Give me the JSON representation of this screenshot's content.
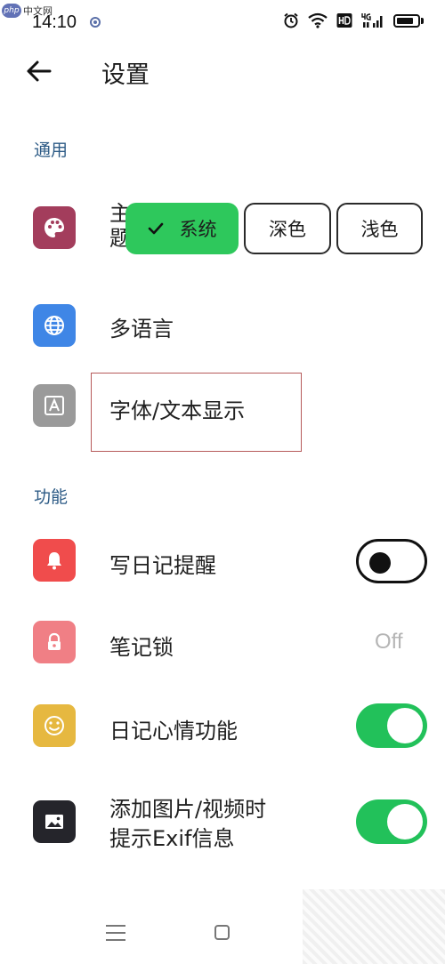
{
  "status_bar": {
    "time": "14:10",
    "watermark": "中文网",
    "watermark_logo": "php"
  },
  "header": {
    "title": "设置"
  },
  "sections": {
    "general": "通用",
    "features": "功能"
  },
  "rows": {
    "theme": {
      "label_line1": "主",
      "label_line2": "题",
      "icon": "palette-icon",
      "icon_color": "#a33d5c"
    },
    "language": {
      "label": "多语言",
      "icon": "globe-icon",
      "icon_color": "#3f86e6"
    },
    "font": {
      "label": "字体/文本显示",
      "icon": "font-a-icon",
      "icon_color": "#9a9a9a"
    },
    "diary_reminder": {
      "label": "写日记提醒",
      "icon": "bell-icon",
      "icon_color": "#f04c4c",
      "toggle_on": false
    },
    "note_lock": {
      "label": "笔记锁",
      "icon": "lock-icon",
      "icon_color": "#f07f85",
      "value": "Off"
    },
    "mood": {
      "label": "日记心情功能",
      "icon": "smiley-icon",
      "icon_color": "#e6b840",
      "toggle_on": true
    },
    "exif": {
      "label_line1": "添加图片/视频时",
      "label_line2": "提示Exif信息",
      "icon": "image-icon",
      "icon_color": "#25252b",
      "toggle_on": true
    }
  },
  "theme_options": {
    "system": "系统",
    "dark": "深色",
    "light": "浅色",
    "selected": "system"
  },
  "colors": {
    "accent_green": "#2ec85c",
    "section_blue": "#2d5b86"
  }
}
